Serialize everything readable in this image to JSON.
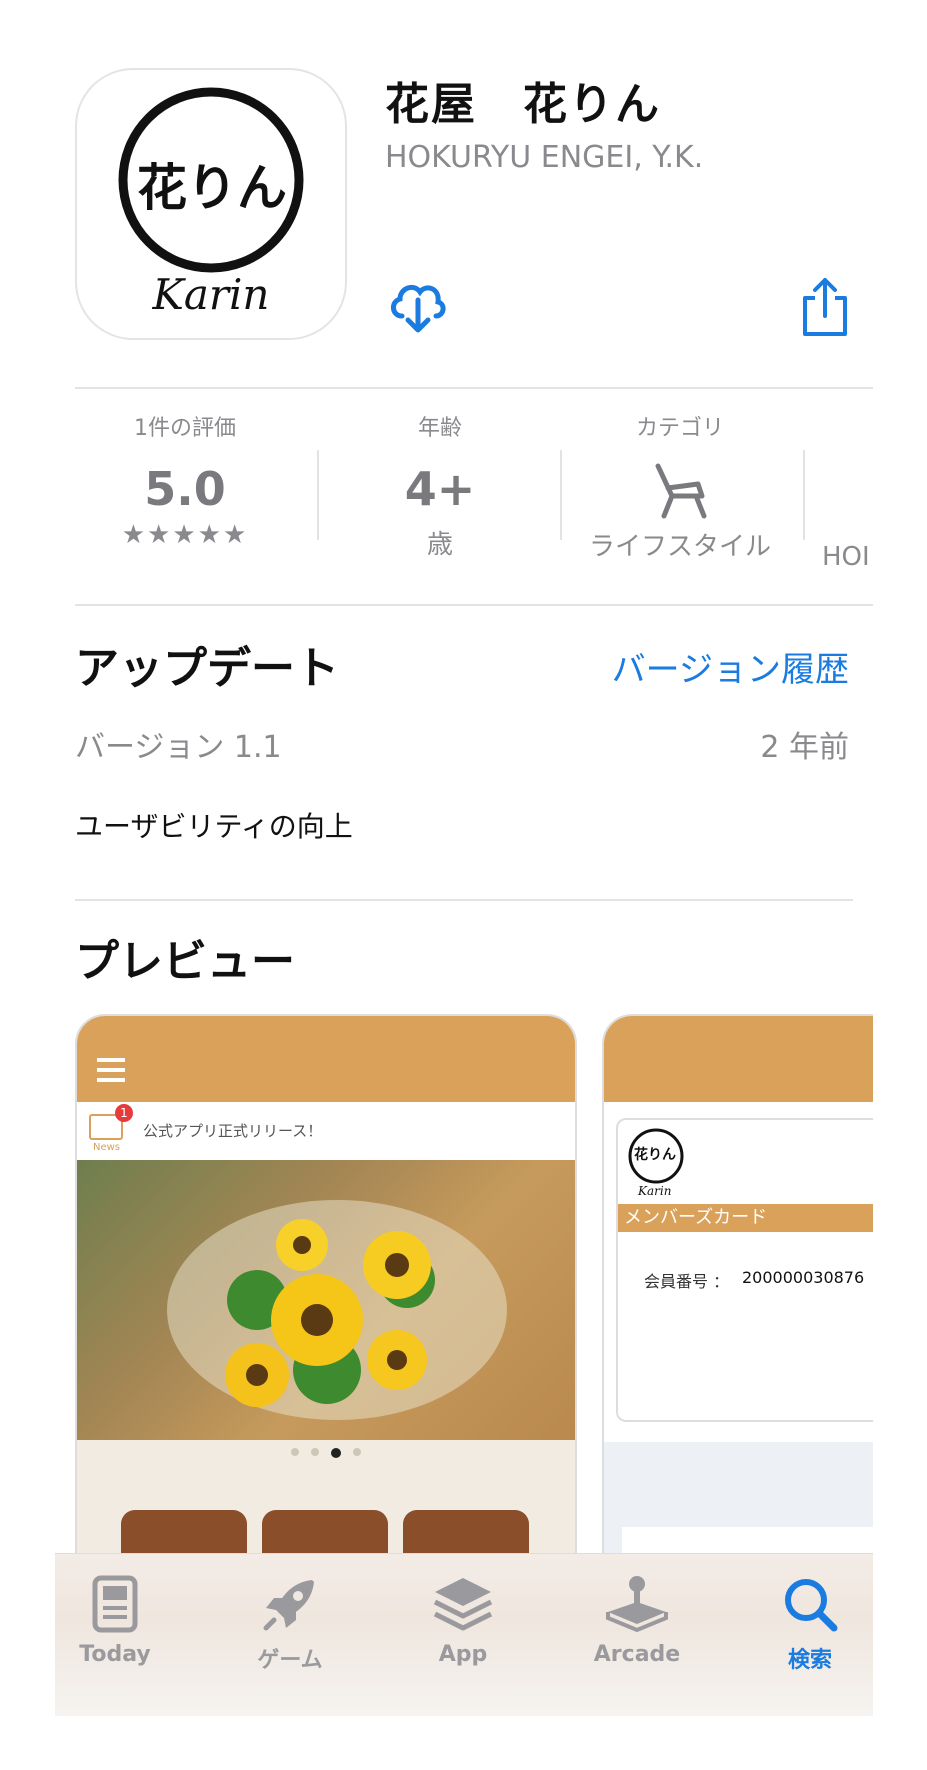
{
  "app": {
    "title": "花屋　花りん",
    "developer": "HOKURYU ENGEI, Y.K.",
    "icon_text_kanji": "花りん",
    "icon_text_latin": "Karin"
  },
  "stats": [
    {
      "label": "1件の評価",
      "value": "5.0",
      "sub": "★★★★★"
    },
    {
      "label": "年齢",
      "value": "4+",
      "sub": "歳"
    },
    {
      "label": "カテゴリ",
      "value": "",
      "sub": "ライフスタイル",
      "icon": "chair-icon"
    },
    {
      "label": "",
      "value": "",
      "sub": "HOI"
    }
  ],
  "update": {
    "title": "アップデート",
    "history_link": "バージョン履歴",
    "version": "バージョン 1.1",
    "age": "2 年前",
    "notes": "ユーザビリティの向上"
  },
  "preview": {
    "title": "プレビュー",
    "shot1": {
      "news_text": "公式アプリ正式リリース！",
      "news_badge": "1",
      "news_label": "News"
    },
    "shot2": {
      "card_title": "メンバーズカード",
      "member_label": "会員番号 ：",
      "member_number": "200000030876",
      "logo_kanji": "花りん",
      "logo_latin": "Karin"
    }
  },
  "tabs": [
    {
      "label": "Today",
      "icon": "today-icon"
    },
    {
      "label": "ゲーム",
      "icon": "rocket-icon"
    },
    {
      "label": "App",
      "icon": "layers-icon"
    },
    {
      "label": "Arcade",
      "icon": "joystick-icon"
    },
    {
      "label": "検索",
      "icon": "search-icon",
      "active": true
    }
  ],
  "colors": {
    "accent": "#1a7be0",
    "brand_orange": "#d9a15a",
    "gray_text": "#8a8a8e"
  }
}
